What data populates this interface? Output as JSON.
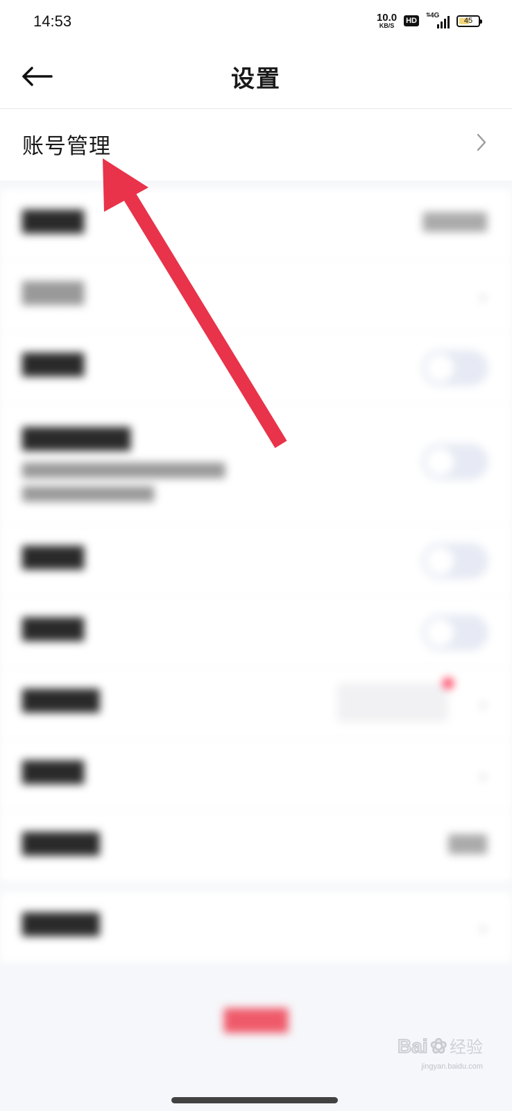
{
  "status_bar": {
    "time": "14:53",
    "net_speed": "10.0",
    "net_speed_unit": "KB/S",
    "hd": "HD",
    "network": "4G",
    "battery": "45"
  },
  "nav": {
    "title": "设置",
    "back_icon": "arrow-left-icon"
  },
  "account": {
    "label": "账号管理",
    "chevron_icon": "chevron-right-icon"
  },
  "colors": {
    "accent_arrow": "#e8334a",
    "toggle_track": "#e7eaf4",
    "logout_text": "#ef5a6a"
  },
  "watermark": {
    "brand": "Bai",
    "brand2": "经验",
    "site": "jingyan.baidu.com"
  }
}
